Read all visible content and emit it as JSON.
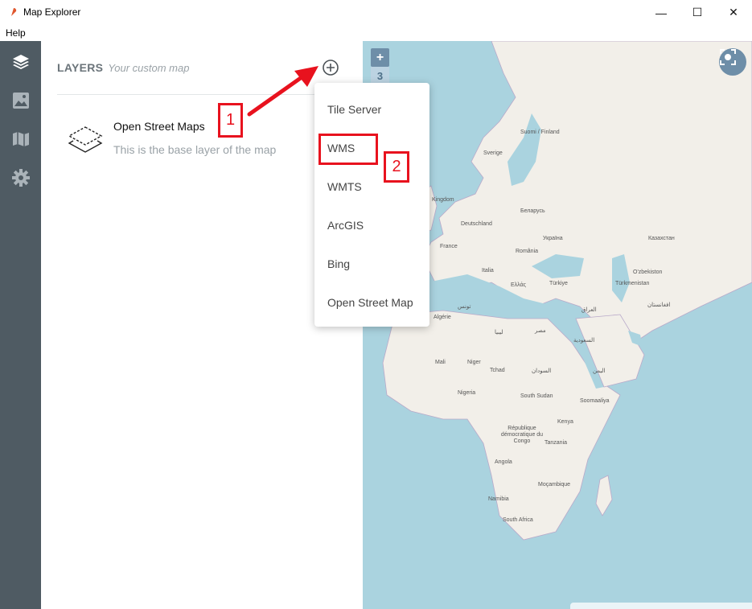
{
  "window": {
    "title": "Map Explorer",
    "minimize_glyph": "—",
    "maximize_glyph": "☐",
    "close_glyph": "✕"
  },
  "menubar": {
    "help": "Help"
  },
  "rail": {
    "items": [
      {
        "icon": "layers-icon"
      },
      {
        "icon": "image-icon"
      },
      {
        "icon": "map-icon"
      },
      {
        "icon": "gear-icon"
      }
    ]
  },
  "panel": {
    "title": "LAYERS",
    "subtitle": "Your custom map",
    "add_icon": "plus-circle-icon",
    "layers": [
      {
        "name": "Open Street Maps",
        "description": "This is the base layer of the map"
      }
    ]
  },
  "map": {
    "zoom_in": "+",
    "zoom_level": "3",
    "labels": [
      "Suomi / Finland",
      "Sverige",
      "Kingdom",
      "Deutschland",
      "Беларусь",
      "France",
      "Україна",
      "Казахстан",
      "România",
      "Italia",
      "Türkiye",
      "Ελλάς",
      "O'zbekiston",
      "Türkmenistan",
      "Algérie",
      "تونس",
      "ليبيا",
      "مصر",
      "العراق",
      "افغانستان",
      "السعودية",
      "Mali",
      "Niger",
      "Tchad",
      "السودان",
      "اليمن",
      "Nigeria",
      "South Sudan",
      "Soomaaliya",
      "Kenya",
      "République démocratique du Congo",
      "Tanzania",
      "Angola",
      "Moçambique",
      "Namibia",
      "South Africa"
    ]
  },
  "dropdown": {
    "items": [
      "Tile Server",
      "WMS",
      "WMTS",
      "ArcGIS",
      "Bing",
      "Open Street Map"
    ]
  },
  "annotations": {
    "step1": "1",
    "step2": "2",
    "color": "#e8121e"
  }
}
